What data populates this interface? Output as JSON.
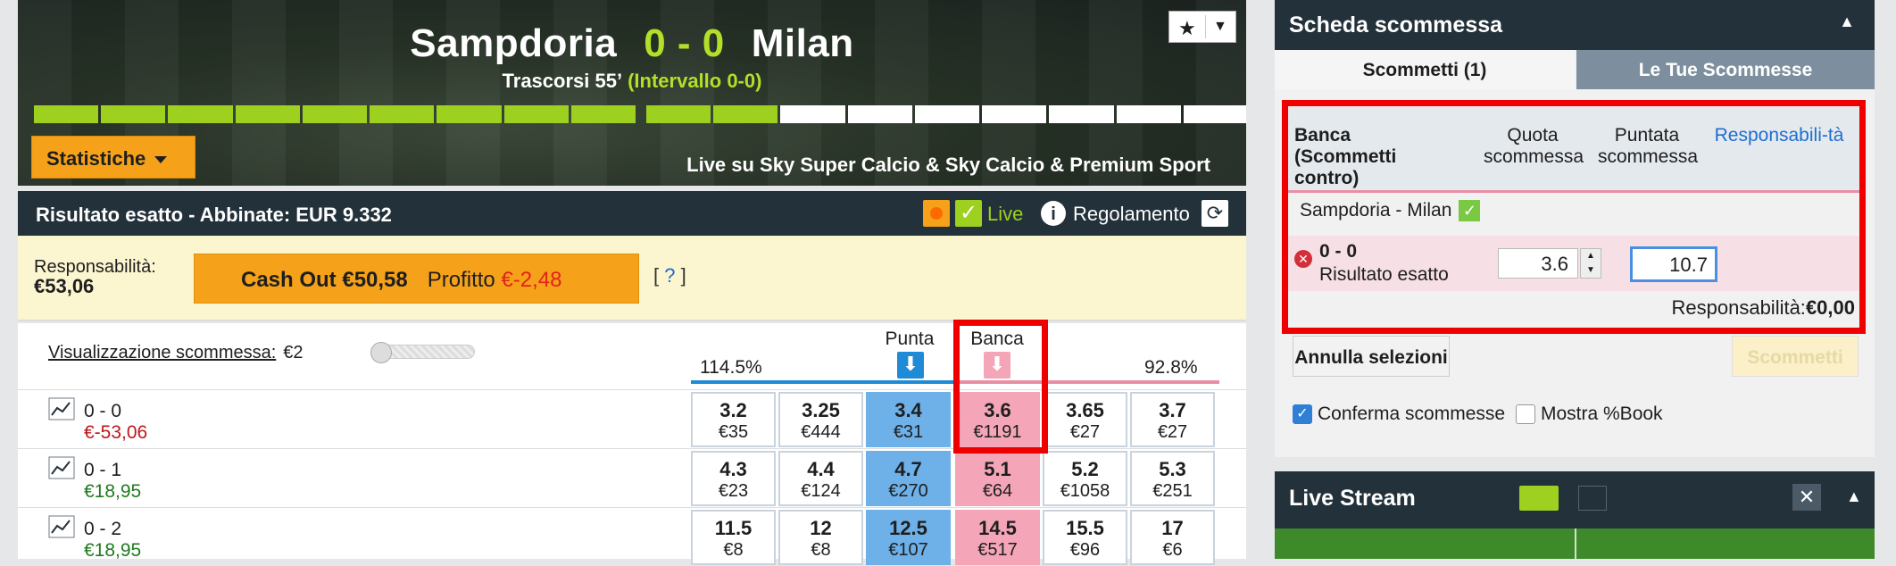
{
  "header": {
    "home_team": "Sampdoria",
    "score": "0 - 0",
    "away_team": "Milan",
    "elapsed": "Trascorsi 55’",
    "halftime": "(Intervallo 0-0)",
    "stats_button": "Statistiche",
    "broadcast": "Live su Sky Super Calcio & Sky Calcio & Premium Sport"
  },
  "market": {
    "title": "Risultato esatto - Abbinate: EUR 9.332",
    "live_label": "Live",
    "rules_label": "Regolamento"
  },
  "cashout": {
    "liability_label": "Responsabilità:",
    "liability_value": "€53,06",
    "button_label": "Cash Out €50,58",
    "profit_label": "Profitto",
    "profit_value": "€-2,48",
    "help": "?"
  },
  "grid": {
    "view_label": "Visualizzazione scommessa:",
    "view_value": "€2",
    "back_pct": "114.5%",
    "lay_pct": "92.8%",
    "back_header": "Punta",
    "lay_header": "Banca",
    "rows": [
      {
        "label": "0 - 0",
        "pl": "€-53,06",
        "cells": [
          {
            "o": "3.2",
            "m": "€35"
          },
          {
            "o": "3.25",
            "m": "€444"
          },
          {
            "o": "3.4",
            "m": "€31"
          },
          {
            "o": "3.6",
            "m": "€1191"
          },
          {
            "o": "3.65",
            "m": "€27"
          },
          {
            "o": "3.7",
            "m": "€27"
          }
        ]
      },
      {
        "label": "0 - 1",
        "pl": "€18,95",
        "cells": [
          {
            "o": "4.3",
            "m": "€23"
          },
          {
            "o": "4.4",
            "m": "€124"
          },
          {
            "o": "4.7",
            "m": "€270"
          },
          {
            "o": "5.1",
            "m": "€64"
          },
          {
            "o": "5.2",
            "m": "€1058"
          },
          {
            "o": "5.3",
            "m": "€251"
          }
        ]
      },
      {
        "label": "0 - 2",
        "pl": "€18,95",
        "cells": [
          {
            "o": "11.5",
            "m": "€8"
          },
          {
            "o": "12",
            "m": "€8"
          },
          {
            "o": "12.5",
            "m": "€107"
          },
          {
            "o": "14.5",
            "m": "€517"
          },
          {
            "o": "15.5",
            "m": "€96"
          },
          {
            "o": "17",
            "m": "€6"
          }
        ]
      }
    ]
  },
  "betslip": {
    "title": "Scheda scommessa",
    "tab_active": "Scommetti (1)",
    "tab_other": "Le Tue Scommesse",
    "col_lay": "Banca (Scommetti contro)",
    "col_odds": "Quota scommessa",
    "col_stake": "Puntata scommessa",
    "col_liab": "Responsabili-tà",
    "match": "Sampdoria - Milan",
    "selection": "0 - 0",
    "market_name": "Risultato esatto",
    "odds": "3.6",
    "stake": "10.7",
    "liability_label": "Responsabilità:",
    "liability_value": "€0,00",
    "cancel": "Annulla selezioni",
    "place": "Scommetti",
    "confirm": "Conferma scommesse",
    "show_book": "Mostra %Book"
  },
  "stream": {
    "title": "Live Stream"
  }
}
